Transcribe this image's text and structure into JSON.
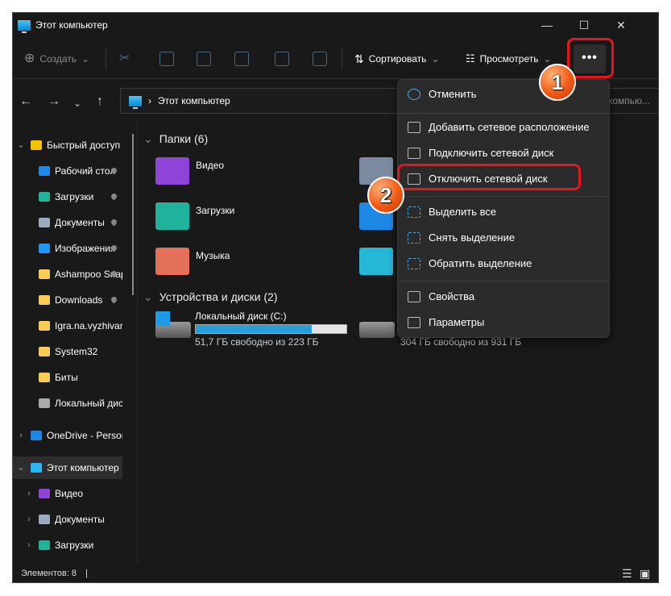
{
  "window": {
    "title": "Этот компьютер",
    "minimize": "—",
    "maximize": "☐",
    "close": "✕"
  },
  "toolbar": {
    "create": "Создать",
    "sort": "Сортировать",
    "view": "Просмотреть",
    "more": "•••"
  },
  "address": {
    "path": "Этот компьютер",
    "search_placeholder": "компью..."
  },
  "sidebar": {
    "items": [
      {
        "label": "Быстрый доступ",
        "icon": "star-icon",
        "color": "#f5c400",
        "level": 0,
        "chevron": "⌄",
        "pinned": false
      },
      {
        "label": "Рабочий стол",
        "icon": "desktop-icon",
        "color": "#1e88e5",
        "level": 1,
        "pinned": true
      },
      {
        "label": "Загрузки",
        "icon": "download-icon",
        "color": "#1fb39c",
        "level": 1,
        "pinned": true
      },
      {
        "label": "Документы",
        "icon": "document-icon",
        "color": "#9aaac0",
        "level": 1,
        "pinned": true
      },
      {
        "label": "Изображения",
        "icon": "pictures-icon",
        "color": "#2196f3",
        "level": 1,
        "pinned": true
      },
      {
        "label": "Ashampoo Snap",
        "icon": "folder-icon",
        "color": "#f9cc54",
        "level": 1,
        "pinned": true
      },
      {
        "label": "Downloads",
        "icon": "folder-icon",
        "color": "#f9cc54",
        "level": 1,
        "pinned": true
      },
      {
        "label": "Igra.na.vyzhivanie",
        "icon": "folder-icon",
        "color": "#f9cc54",
        "level": 1,
        "pinned": false
      },
      {
        "label": "System32",
        "icon": "folder-icon",
        "color": "#f9cc54",
        "level": 1,
        "pinned": false
      },
      {
        "label": "Биты",
        "icon": "folder-icon",
        "color": "#f9cc54",
        "level": 1,
        "pinned": false
      },
      {
        "label": "Локальный диск",
        "icon": "drive-icon",
        "color": "#aaaaaa",
        "level": 1,
        "pinned": false
      },
      {
        "label": "OneDrive - Personal",
        "icon": "cloud-icon",
        "color": "#1e88e5",
        "level": 0,
        "chevron": "›",
        "pinned": false
      },
      {
        "label": "Этот компьютер",
        "icon": "computer-icon",
        "color": "#29b6f6",
        "level": 0,
        "chevron": "⌄",
        "pinned": false,
        "selected": true
      },
      {
        "label": "Видео",
        "icon": "video-icon",
        "color": "#8e44d8",
        "level": 1,
        "chevron": "›",
        "pinned": false
      },
      {
        "label": "Документы",
        "icon": "document-icon",
        "color": "#9aaac0",
        "level": 1,
        "chevron": "›",
        "pinned": false
      },
      {
        "label": "Загрузки",
        "icon": "download-icon",
        "color": "#1fb39c",
        "level": 1,
        "chevron": "›",
        "pinned": false
      }
    ]
  },
  "main": {
    "folders_header": "Папки (6)",
    "folders": [
      {
        "label": "Видео",
        "icon": "video-folder-icon",
        "color": "#8e44d8"
      },
      {
        "label": "Загрузки",
        "icon": "downloads-folder-icon",
        "color": "#1fb39c"
      },
      {
        "label": "Музыка",
        "icon": "music-folder-icon",
        "color": "#e5705a"
      }
    ],
    "drives_header": "Устройства и диски (2)",
    "drives": [
      {
        "label": "Локальный диск (C:)",
        "info": "51,7 ГБ свободно из 223 ГБ",
        "used_percent": 77
      },
      {
        "label": "",
        "info": "304 ГБ свободно из 931 ГБ",
        "used_percent": 67
      }
    ]
  },
  "menu": {
    "items": [
      {
        "label": "Отменить",
        "icon": "undo-icon"
      },
      {
        "label": "Добавить сетевое расположение",
        "icon": "add-network-location-icon"
      },
      {
        "label": "Подключить сетевой диск",
        "icon": "map-network-drive-icon"
      },
      {
        "label": "Отключить сетевой диск",
        "icon": "disconnect-network-drive-icon"
      },
      {
        "label": "Выделить все",
        "icon": "select-all-icon"
      },
      {
        "label": "Снять выделение",
        "icon": "select-none-icon"
      },
      {
        "label": "Обратить выделение",
        "icon": "invert-selection-icon"
      },
      {
        "label": "Свойства",
        "icon": "properties-icon"
      },
      {
        "label": "Параметры",
        "icon": "options-icon"
      }
    ]
  },
  "annotations": {
    "step1": "1",
    "step2": "2",
    "highlight_color": "#e8161c"
  },
  "status": {
    "count": "Элементов: 8"
  }
}
